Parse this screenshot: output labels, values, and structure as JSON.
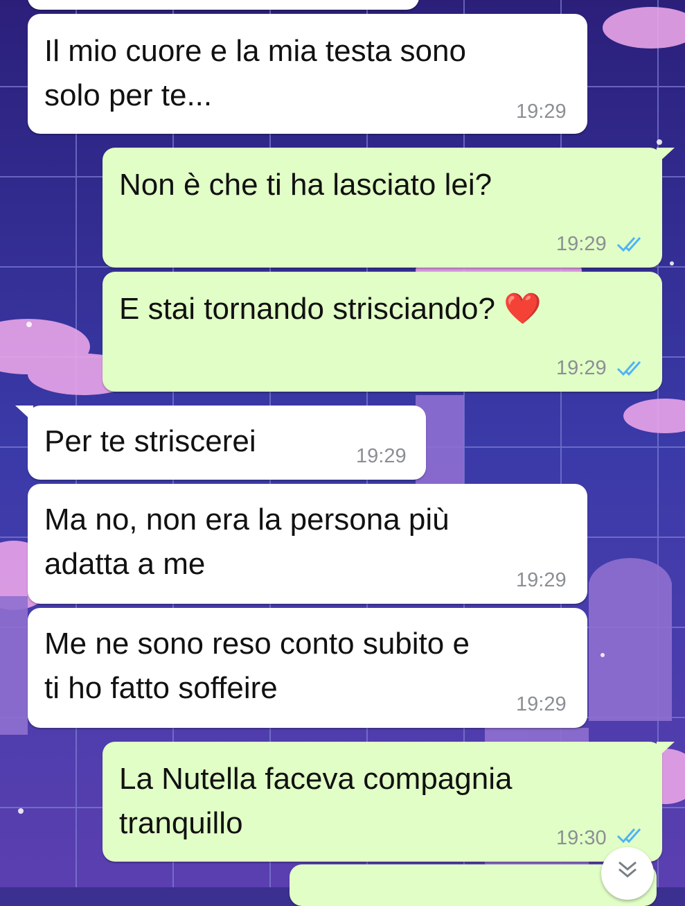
{
  "chat": {
    "messages": [
      {
        "direction": "in",
        "text": "Il mio cuore e la mia testa sono\nsolo per te...",
        "time": "19:29"
      },
      {
        "direction": "out",
        "text": "Non è che ti ha lasciato lei?",
        "time": "19:29",
        "status": "read"
      },
      {
        "direction": "out",
        "text": "E stai tornando strisciando? ❤️",
        "time": "19:29",
        "status": "read"
      },
      {
        "direction": "in",
        "text": "Per te striscerei",
        "time": "19:29"
      },
      {
        "direction": "in",
        "text": "Ma no, non era la persona più\nadatta a me",
        "time": "19:29"
      },
      {
        "direction": "in",
        "text": "Me ne sono reso conto subito e\nti ho fatto soffeire",
        "time": "19:29"
      },
      {
        "direction": "out",
        "text": "La Nutella faceva compagnia\ntranquillo",
        "time": "19:30",
        "status": "read"
      }
    ]
  },
  "colors": {
    "incoming_bubble": "#ffffff",
    "outgoing_bubble": "#e1fec6",
    "read_ticks": "#4fb3f6",
    "timestamp": "#8b8f94"
  },
  "icons": {
    "read_receipt": "double-check-icon",
    "scroll_down": "chevron-double-down-icon"
  }
}
